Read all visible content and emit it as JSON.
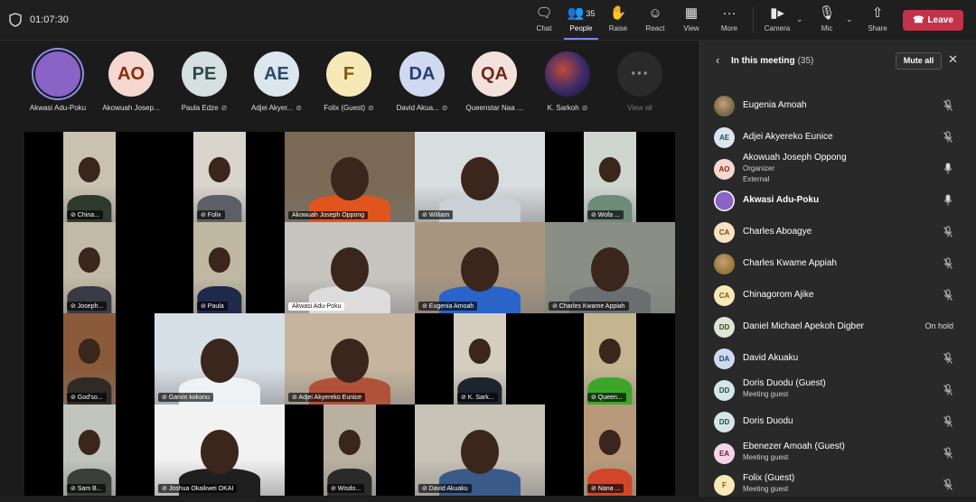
{
  "meeting": {
    "timer": "01:07:30"
  },
  "toolbar": {
    "chat": "Chat",
    "people": "People",
    "people_count": "35",
    "raise": "Raise",
    "react": "React",
    "view": "View",
    "more": "More",
    "camera": "Camera",
    "mic": "Mic",
    "share": "Share",
    "leave": "Leave"
  },
  "strip": [
    {
      "initials": "",
      "name": "Akwasi Adu-Poku",
      "bg": "#8a63c7",
      "fg": "#fff",
      "muted": false
    },
    {
      "initials": "AO",
      "name": "Akowuah Josep...",
      "bg": "#f5d8cf",
      "fg": "#8a2b13",
      "muted": false
    },
    {
      "initials": "PE",
      "name": "Paula Edze",
      "bg": "#d7e0e0",
      "fg": "#2d4a4a",
      "muted": true
    },
    {
      "initials": "AE",
      "name": "Adjei Akyer...",
      "bg": "#dbe6ee",
      "fg": "#2a4a66",
      "muted": true
    },
    {
      "initials": "F",
      "name": "Folix (Guest)",
      "bg": "#f7e8b8",
      "fg": "#7a5a0a",
      "muted": true
    },
    {
      "initials": "DA",
      "name": "David Akua...",
      "bg": "#cfdaf0",
      "fg": "#2a3f73",
      "muted": true
    },
    {
      "initials": "QA",
      "name": "Queenstar Naa ...",
      "bg": "#f3e2db",
      "fg": "#6b2b1a",
      "muted": false
    },
    {
      "initials": "",
      "name": "K. Sarkoh",
      "bg": "#3b2a6a",
      "fg": "#fff",
      "muted": true
    },
    {
      "initials": "···",
      "name": "View all",
      "bg": "#2a2a2a",
      "fg": "#9a9a9a",
      "muted": false
    }
  ],
  "tiles": [
    {
      "name": "China...",
      "bg": "#c9c2b0",
      "body": "#2e3a2e",
      "muted": true
    },
    {
      "name": "Folix",
      "bg": "#d9d4cc",
      "body": "#5c5f66",
      "muted": true
    },
    {
      "name": "Akowuah Joseph Oppong",
      "bg": "#7a6a55",
      "body": "#e0541e",
      "muted": false
    },
    {
      "name": "William",
      "bg": "#d8dde0",
      "body": "#c9d1d6",
      "muted": true
    },
    {
      "name": "Wofa ...",
      "bg": "#cfd6d0",
      "body": "#6e8a7a",
      "muted": true
    },
    {
      "name": "Joseph...",
      "bg": "#c3b9a8",
      "body": "#3a3a44",
      "muted": true
    },
    {
      "name": "Paula",
      "bg": "#bfb9a4",
      "body": "#1f2a4a",
      "muted": true
    },
    {
      "name": "Akwasi Adu-Poku",
      "bg": "#c8c4c0",
      "body": "#dcdcdc",
      "muted": false,
      "light": true
    },
    {
      "name": "Eugenia Amoah",
      "bg": "#a89580",
      "body": "#2a64c8",
      "muted": true
    },
    {
      "name": "Charles Kwame Appiah",
      "bg": "#8a8f86",
      "body": "#6a6e70",
      "muted": true
    },
    {
      "name": "God'so...",
      "bg": "#8a5a3a",
      "body": "#2e2a26",
      "muted": true
    },
    {
      "name": "Garvin kokonu",
      "bg": "#d7dfe6",
      "body": "#eef2f5",
      "muted": true
    },
    {
      "name": "Adjei Akyereko Eunice",
      "bg": "#c6b59e",
      "body": "#b0523a",
      "muted": true
    },
    {
      "name": "K. Sark...",
      "bg": "#d4cdc0",
      "body": "#1f2530",
      "muted": true
    },
    {
      "name": "Queen...",
      "bg": "#c3b590",
      "body": "#3da62a",
      "muted": true
    },
    {
      "name": "Sam B...",
      "bg": "#c0c4bc",
      "body": "#3a3f3a",
      "muted": true
    },
    {
      "name": "Joshua Okaikwei OKAI",
      "bg": "#f2f2f2",
      "body": "#1f1f1f",
      "muted": true
    },
    {
      "name": "Wisdo...",
      "bg": "#b8b0a0",
      "body": "#2a2a2a",
      "muted": true
    },
    {
      "name": "David Akuaku",
      "bg": "#c7c2b6",
      "body": "#3a5a8a",
      "muted": true
    },
    {
      "name": "Nana ...",
      "bg": "#b89a7a",
      "body": "#d2452a",
      "muted": true
    }
  ],
  "panel": {
    "title": "In this meeting",
    "count": "(35)",
    "mute_all": "Mute all",
    "people": [
      {
        "initials": "",
        "name": "Eugenia Amoah",
        "sub1": "",
        "sub2": "",
        "status": "mic-off",
        "bg": "#7a6a4a",
        "fg": "#fff",
        "bold": false
      },
      {
        "initials": "AE",
        "name": "Adjei Akyereko Eunice",
        "sub1": "",
        "sub2": "",
        "status": "mic-off",
        "bg": "#dbe6ee",
        "fg": "#2a4a66",
        "bold": false
      },
      {
        "initials": "AO",
        "name": "Akowuah Joseph Oppong",
        "sub1": "Organizer",
        "sub2": "External",
        "status": "mic-on",
        "bg": "#f5d8cf",
        "fg": "#8a2b13",
        "bold": false
      },
      {
        "initials": "",
        "name": "Akwasi Adu-Poku",
        "sub1": "",
        "sub2": "",
        "status": "mic-on",
        "bg": "#8a63c7",
        "fg": "#fff",
        "bold": true
      },
      {
        "initials": "CA",
        "name": "Charles Aboagye",
        "sub1": "",
        "sub2": "",
        "status": "mic-off",
        "bg": "#f7e3c4",
        "fg": "#7a4a0a",
        "bold": false
      },
      {
        "initials": "",
        "name": "Charles Kwame Appiah",
        "sub1": "",
        "sub2": "",
        "status": "mic-off",
        "bg": "#9a7a3a",
        "fg": "#fff",
        "bold": false
      },
      {
        "initials": "CA",
        "name": "Chinagorom Ajike",
        "sub1": "",
        "sub2": "",
        "status": "mic-off",
        "bg": "#f7e8b8",
        "fg": "#7a5a0a",
        "bold": false
      },
      {
        "initials": "DD",
        "name": "Daniel Michael Apekoh Digber",
        "sub1": "",
        "sub2": "",
        "status": "On hold",
        "bg": "#dfe6d5",
        "fg": "#3a4a2a",
        "bold": false
      },
      {
        "initials": "DA",
        "name": "David Akuaku",
        "sub1": "",
        "sub2": "",
        "status": "mic-off",
        "bg": "#cfdaf0",
        "fg": "#2a3f73",
        "bold": false
      },
      {
        "initials": "DD",
        "name": "Doris Duodu (Guest)",
        "sub1": "Meeting guest",
        "sub2": "",
        "status": "mic-off",
        "bg": "#d5e6e6",
        "fg": "#2a4a4a",
        "bold": false
      },
      {
        "initials": "DD",
        "name": "Doris Duodu",
        "sub1": "",
        "sub2": "",
        "status": "mic-off",
        "bg": "#d5e6e6",
        "fg": "#2a4a4a",
        "bold": false
      },
      {
        "initials": "EA",
        "name": "Ebenezer Amoah (Guest)",
        "sub1": "Meeting guest",
        "sub2": "",
        "status": "mic-off",
        "bg": "#f3d6e6",
        "fg": "#7a1a4a",
        "bold": false
      },
      {
        "initials": "F",
        "name": "Folix (Guest)",
        "sub1": "Meeting guest",
        "sub2": "",
        "status": "mic-off",
        "bg": "#f7e8b8",
        "fg": "#7a5a0a",
        "bold": false
      }
    ]
  }
}
